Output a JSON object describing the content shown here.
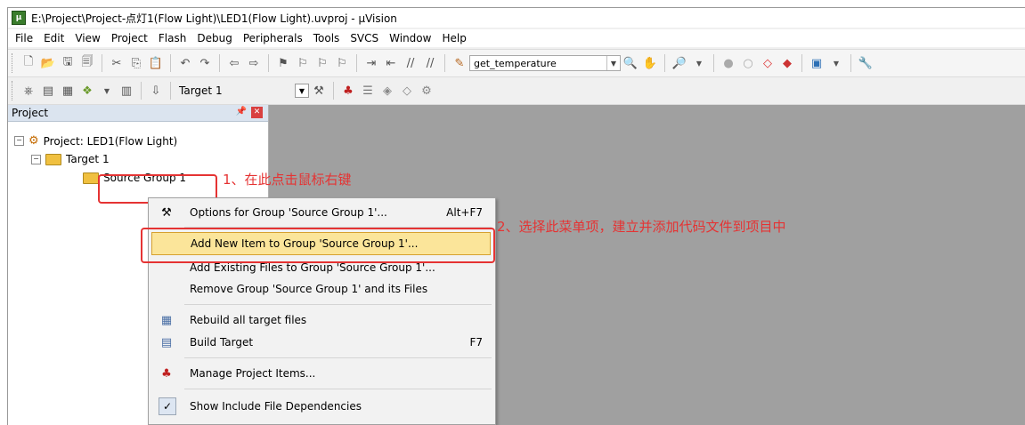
{
  "window": {
    "title": "E:\\Project\\Project-点灯1(Flow Light)\\LED1(Flow Light).uvproj - µVision",
    "icon": "uvision-app-icon"
  },
  "menubar": [
    "File",
    "Edit",
    "View",
    "Project",
    "Flash",
    "Debug",
    "Peripherals",
    "Tools",
    "SVCS",
    "Window",
    "Help"
  ],
  "toolbar": {
    "function_combo_value": "get_temperature"
  },
  "build_toolbar": {
    "target_value": "Target 1"
  },
  "project_panel": {
    "title": "Project",
    "tree": {
      "project": "Project: LED1(Flow Light)",
      "target": "Target 1",
      "group": "Source Group 1"
    }
  },
  "context_menu": {
    "items": [
      {
        "label": "Options for Group 'Source Group 1'...",
        "shortcut": "Alt+F7",
        "icon": "options-icon"
      },
      {
        "label": "Add New  Item to Group 'Source Group 1'...",
        "shortcut": "",
        "icon": ""
      },
      {
        "label": "Add Existing Files to Group 'Source Group 1'...",
        "shortcut": "",
        "icon": ""
      },
      {
        "label": "Remove Group 'Source Group 1' and its Files",
        "shortcut": "",
        "icon": ""
      },
      {
        "label": "Rebuild all target files",
        "shortcut": "",
        "icon": "rebuild-icon"
      },
      {
        "label": "Build Target",
        "shortcut": "F7",
        "icon": "build-icon"
      },
      {
        "label": "Manage Project Items...",
        "shortcut": "",
        "icon": "manage-items-icon"
      },
      {
        "label": "Show Include File Dependencies",
        "shortcut": "",
        "icon": "checkmark-icon"
      }
    ]
  },
  "annotations": {
    "step1": "1、在此点击鼠标右键",
    "step2": "2、选择此菜单项，建立并添加代码文件到项目中"
  },
  "colors": {
    "annotation_red": "#e53333",
    "menu_highlight": "#fbe59a",
    "editor_bg": "#a0a0a0"
  }
}
